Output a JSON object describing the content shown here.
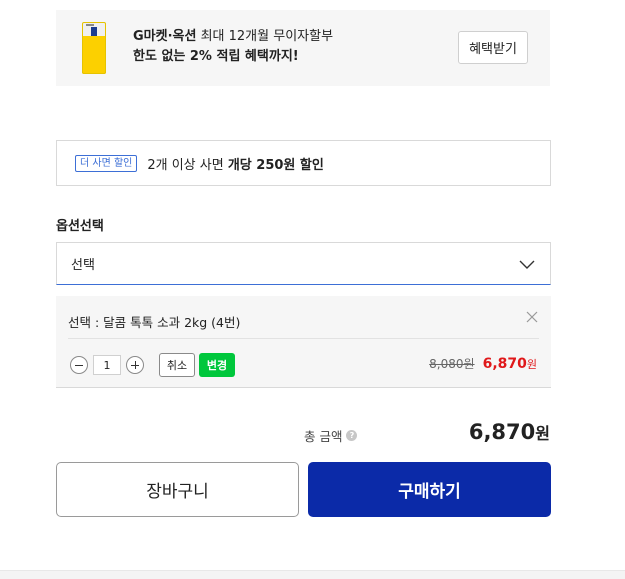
{
  "promo": {
    "brand": "G마켓·옥션",
    "line1_rest": " 최대 12개월 무이자할부",
    "line2": "한도 없는 2% 적립 혜택까지!",
    "button_label": "혜택받기"
  },
  "discount": {
    "badge": "더 사면 할인",
    "text_prefix": "2개 이상 사면 ",
    "text_strong": "개당 250원 할인"
  },
  "options": {
    "label": "옵션선택",
    "select_value": "선택"
  },
  "selected_item": {
    "name": "선택 : 달콤 톡톡 소과 2kg (4번)",
    "quantity": "1",
    "cancel_label": "취소",
    "change_label": "변경",
    "original_price": "8,080원",
    "sale_price_number": "6,870",
    "sale_price_unit": "원"
  },
  "total": {
    "label": "총 금액",
    "help_icon_glyph": "?",
    "amount_number": "6,870",
    "amount_unit": "원"
  },
  "actions": {
    "cart_label": "장바구니",
    "buy_label": "구매하기"
  },
  "colors": {
    "buy_button": "#0b2aa8",
    "sale_price": "#e0181a",
    "change_button": "#00c73c",
    "discount_badge": "#3d6fd6"
  }
}
